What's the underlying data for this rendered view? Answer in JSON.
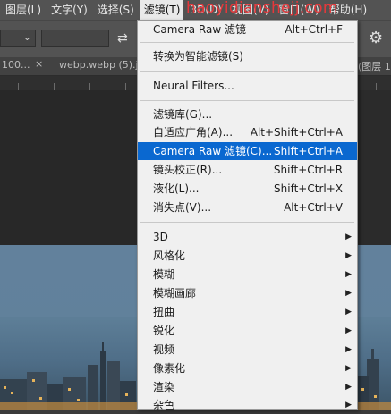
{
  "menubar": {
    "items": [
      {
        "label": "图层(L)"
      },
      {
        "label": "文字(Y)"
      },
      {
        "label": "选择(S)"
      },
      {
        "label": "滤镜(T)",
        "active": true
      },
      {
        "label": "3D(D)"
      },
      {
        "label": "视图(V)"
      },
      {
        "label": "窗口(W)"
      },
      {
        "label": "帮助(H)"
      }
    ]
  },
  "watermark": "haoyidianshejj.com",
  "options": {
    "select_chevron": "chevron-down-icon",
    "swap_icon": "swap-icon",
    "settings_icon": "gear-icon"
  },
  "tabs": {
    "tab1": "100...",
    "tab1_close": "×",
    "tab2": "webp.webp (5).j",
    "tab3": "(图层 1"
  },
  "filter_menu": {
    "items": [
      {
        "label": "Camera Raw 滤镜",
        "shortcut": "Alt+Ctrl+F"
      },
      {
        "label": "转换为智能滤镜(S)",
        "shortcut": ""
      },
      {
        "label": "Neural Filters...",
        "shortcut": ""
      },
      {
        "label": "滤镜库(G)...",
        "shortcut": ""
      },
      {
        "label": "自适应广角(A)...",
        "shortcut": "Alt+Shift+Ctrl+A"
      },
      {
        "label": "Camera Raw 滤镜(C)...",
        "shortcut": "Shift+Ctrl+A",
        "highlighted": true
      },
      {
        "label": "镜头校正(R)...",
        "shortcut": "Shift+Ctrl+R"
      },
      {
        "label": "液化(L)...",
        "shortcut": "Shift+Ctrl+X"
      },
      {
        "label": "消失点(V)...",
        "shortcut": "Alt+Ctrl+V"
      },
      {
        "label": "3D",
        "submenu": true
      },
      {
        "label": "风格化",
        "submenu": true
      },
      {
        "label": "模糊",
        "submenu": true
      },
      {
        "label": "模糊画廊",
        "submenu": true
      },
      {
        "label": "扭曲",
        "submenu": true
      },
      {
        "label": "锐化",
        "submenu": true
      },
      {
        "label": "视频",
        "submenu": true
      },
      {
        "label": "像素化",
        "submenu": true
      },
      {
        "label": "渲染",
        "submenu": true
      },
      {
        "label": "杂色",
        "submenu": true
      }
    ]
  },
  "colors": {
    "menu_highlight": "#0a68d0",
    "watermark": "#e5383b",
    "menubar_bg": "#535353"
  }
}
